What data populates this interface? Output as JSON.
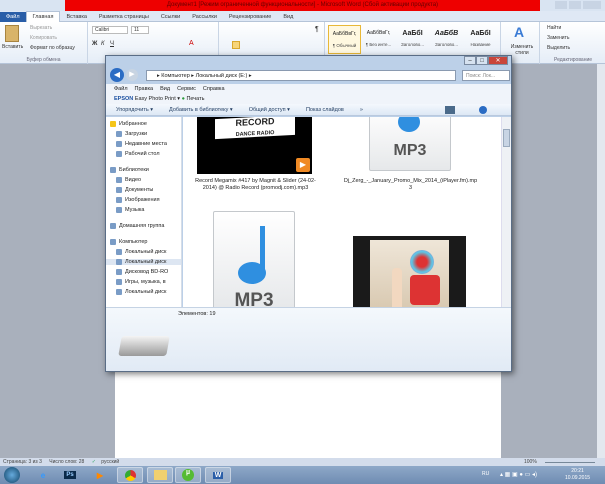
{
  "word": {
    "title": "Документ1 [Режим ограниченной функциональности] - Microsoft Word (Сбой активации продукта)",
    "tabs": [
      "Файл",
      "Главная",
      "Вставка",
      "Разметка страницы",
      "Ссылки",
      "Рассылки",
      "Рецензирование",
      "Вид"
    ],
    "clipboard": {
      "paste": "Вставить",
      "cut": "Вырезать",
      "copy": "Копировать",
      "format_painter": "Формат по образцу",
      "group": "Буфер обмена"
    },
    "font": {
      "name": "Calibri",
      "size": "11"
    },
    "styles": [
      {
        "sample": "АаБбВвГг,",
        "name": "¶ Обычный"
      },
      {
        "sample": "АаБбВвГг,",
        "name": "¶ Без инте..."
      },
      {
        "sample": "АаБбI",
        "name": "Заголово..."
      },
      {
        "sample": "АаБбВ",
        "name": "Заголово..."
      },
      {
        "sample": "АаБбI",
        "name": "Название"
      }
    ],
    "change_styles": "Изменить стили",
    "editing": {
      "find": "Найти",
      "replace": "Заменить",
      "select": "Выделить",
      "group": "Редактирование"
    },
    "status": {
      "page": "Страница: 3 из 3",
      "words": "Число слов: 28",
      "lang": "русский",
      "zoom": "100%"
    }
  },
  "explorer": {
    "breadcrumb": [
      "Компьютер",
      "Локальный диск (E:)"
    ],
    "search_placeholder": "Поиск: Лок...",
    "menu": [
      "Файл",
      "Правка",
      "Вид",
      "Сервис",
      "Справка"
    ],
    "epson": {
      "brand": "EPSON",
      "app": "Easy Photo Print",
      "print": "Печать"
    },
    "commands": [
      "Упорядочить ▾",
      "Добавить в библиотеку ▾",
      "Общий доступ ▾",
      "Показ слайдов",
      "»"
    ],
    "nav": [
      {
        "label": "Избранное",
        "header": true
      },
      {
        "label": "Загрузки"
      },
      {
        "label": "Недавние места"
      },
      {
        "label": "Рабочий стол"
      },
      {
        "label": "Библиотеки",
        "header": true
      },
      {
        "label": "Видео"
      },
      {
        "label": "Документы"
      },
      {
        "label": "Изображения"
      },
      {
        "label": "Музыка"
      },
      {
        "label": "Домашняя группа",
        "header": true
      },
      {
        "label": "Компьютер",
        "header": true
      },
      {
        "label": "Локальный диск"
      },
      {
        "label": "Локальный диск"
      },
      {
        "label": "Дисковод BD-RO"
      },
      {
        "label": "Игры, музыка, в"
      },
      {
        "label": "Локальный диск"
      }
    ],
    "files": [
      {
        "name": "Record Megamix #417 by Magnit & Slider (24-02-2014) @ Radio Record (promodj.com).mp3",
        "thumb_text": "RECORD",
        "thumb_sub": "DANCE RADIO"
      },
      {
        "name": "Dj_Zerg_-_January_Promo_Mix_2014_(iPlayer.fm).mp3",
        "thumb_text": "MP3"
      },
      {
        "name": "",
        "thumb_text": "MP3"
      }
    ],
    "item_count": "Элементов: 19"
  },
  "taskbar": {
    "clock_time": "20:21",
    "clock_date": "10.09.2015",
    "lang": "RU"
  },
  "colors": {
    "title_red": "#e00000",
    "accent": "#2a5ea8"
  }
}
